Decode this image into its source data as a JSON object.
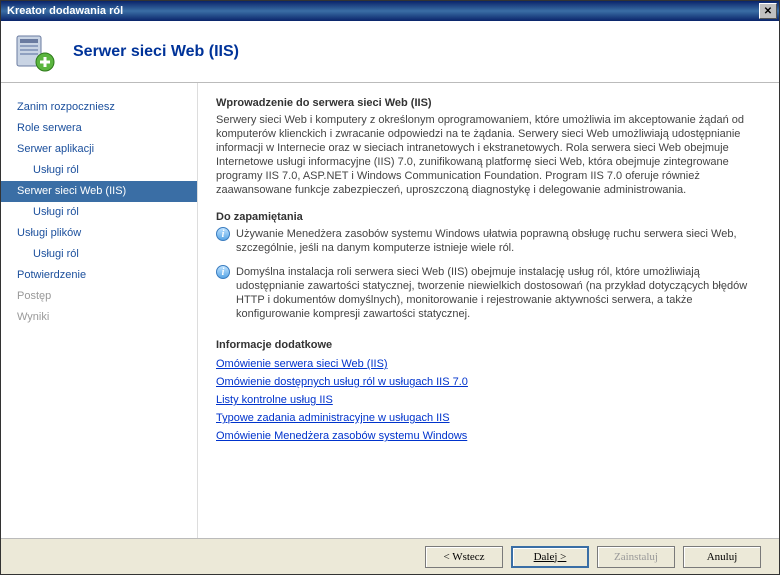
{
  "window": {
    "title": "Kreator dodawania ról"
  },
  "header": {
    "title": "Serwer sieci Web (IIS)"
  },
  "nav": {
    "items": [
      {
        "label": "Zanim rozpoczniesz",
        "indent": false,
        "selected": false,
        "disabled": false
      },
      {
        "label": "Role serwera",
        "indent": false,
        "selected": false,
        "disabled": false
      },
      {
        "label": "Serwer aplikacji",
        "indent": false,
        "selected": false,
        "disabled": false
      },
      {
        "label": "Usługi ról",
        "indent": true,
        "selected": false,
        "disabled": false
      },
      {
        "label": "Serwer sieci Web (IIS)",
        "indent": false,
        "selected": true,
        "disabled": false
      },
      {
        "label": "Usługi ról",
        "indent": true,
        "selected": false,
        "disabled": false
      },
      {
        "label": "Usługi plików",
        "indent": false,
        "selected": false,
        "disabled": false
      },
      {
        "label": "Usługi ról",
        "indent": true,
        "selected": false,
        "disabled": false
      },
      {
        "label": "Potwierdzenie",
        "indent": false,
        "selected": false,
        "disabled": false
      },
      {
        "label": "Postęp",
        "indent": false,
        "selected": false,
        "disabled": true
      },
      {
        "label": "Wyniki",
        "indent": false,
        "selected": false,
        "disabled": true
      }
    ]
  },
  "content": {
    "intro_heading": "Wprowadzenie do serwera sieci Web (IIS)",
    "intro_text": "Serwery sieci Web i komputery z określonym oprogramowaniem, które umożliwia im akceptowanie żądań od komputerów klienckich i zwracanie odpowiedzi na te żądania. Serwery sieci Web umożliwiają udostępnianie informacji w Internecie oraz w sieciach intranetowych i ekstranetowych. Rola serwera sieci Web obejmuje Internetowe usługi informacyjne (IIS) 7.0, zunifikowaną platformę sieci Web, która obejmuje zintegrowane programy IIS 7.0, ASP.NET i Windows Communication Foundation. Program IIS 7.0 oferuje również zaawansowane funkcje zabezpieczeń, uproszczoną diagnostykę i delegowanie administrowania.",
    "notes_heading": "Do zapamiętania",
    "notes": [
      "Używanie Menedżera zasobów systemu Windows ułatwia poprawną obsługę ruchu serwera sieci Web, szczególnie, jeśli na danym komputerze istnieje wiele ról.",
      "Domyślna instalacja roli serwera sieci Web (IIS) obejmuje instalację usług ról, które umożliwiają udostępnianie zawartości statycznej, tworzenie niewielkich dostosowań (na przykład dotyczących błędów HTTP i dokumentów domyślnych), monitorowanie i rejestrowanie aktywności serwera, a także konfigurowanie kompresji zawartości statycznej."
    ],
    "more_heading": "Informacje dodatkowe",
    "links": [
      "Omówienie serwera sieci Web (IIS)",
      "Omówienie dostępnych usług ról w usługach IIS 7.0",
      "Listy kontrolne usług IIS",
      "Typowe zadania administracyjne w usługach IIS",
      "Omówienie Menedżera zasobów systemu Windows"
    ]
  },
  "footer": {
    "back": "< Wstecz",
    "next": "Dalej >",
    "install": "Zainstaluj",
    "cancel": "Anuluj"
  }
}
